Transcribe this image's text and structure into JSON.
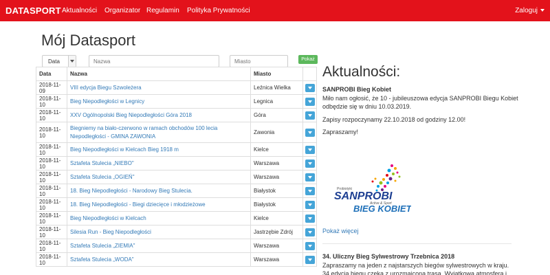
{
  "navbar": {
    "brand": "DATASPORT",
    "items": [
      "Aktualności",
      "Organizator",
      "Regulamin",
      "Polityka Prywatności"
    ],
    "login": "Zaloguj",
    "color": "#e3121b"
  },
  "page_title": "Mój Datasport",
  "filters": {
    "select_value": "Data",
    "name_placeholder": "Nazwa",
    "city_placeholder": "Miasto",
    "show_button": "Pokaż",
    "show_button_color": "#5cb85c"
  },
  "table": {
    "headers": [
      "Data",
      "Nazwa",
      "Miasto"
    ],
    "rows": [
      {
        "date": "2018-11-09",
        "name": "VIII edycja Biegu Szwoleżera",
        "city": "Leźnica Wielka"
      },
      {
        "date": "2018-11-10",
        "name": "Bieg Niepodległości w Legnicy",
        "city": "Legnica"
      },
      {
        "date": "2018-11-10",
        "name": "XXV Ogólnopolski Bieg Niepodległości Góra 2018",
        "city": "Góra"
      },
      {
        "date": "2018-11-10",
        "name": "Biegniemy na biało-czerwono w ramach obchodów 100 lecia Niepodległości - GMINA ZAWONIA",
        "city": "Zawonia"
      },
      {
        "date": "2018-11-10",
        "name": "Bieg Niepodległości w Kielcach Bieg 1918 m",
        "city": "Kielce"
      },
      {
        "date": "2018-11-10",
        "name": "Sztafeta Stulecia „NIEBO\"",
        "city": "Warszawa"
      },
      {
        "date": "2018-11-10",
        "name": "Sztafeta Stulecia „OGIEŃ\"",
        "city": "Warszawa"
      },
      {
        "date": "2018-11-10",
        "name": "18. Bieg Niepodległości - Narodowy Bieg Stulecia.",
        "city": "Białystok"
      },
      {
        "date": "2018-11-10",
        "name": "18. Bieg Niepodległości - Biegi dziecięce i młodzieżowe",
        "city": "Białystok"
      },
      {
        "date": "2018-11-10",
        "name": "Bieg Niepodległości w Kielcach",
        "city": "Kielce"
      },
      {
        "date": "2018-11-10",
        "name": "Silesia Run - Bieg Niepodległości",
        "city": "Jastrzębie Zdrój"
      },
      {
        "date": "2018-11-10",
        "name": "Sztafeta Stulecia „ZIEMIA\"",
        "city": "Warszawa"
      },
      {
        "date": "2018-11-10",
        "name": "Sztafeta Stulecia „WODA\"",
        "city": "Warszawa"
      }
    ],
    "action_icon": "chevron-down-icon",
    "action_color": "#45a5d8"
  },
  "news": {
    "title": "Aktualności:",
    "items": [
      {
        "headline": "SANPROBI Bieg Kobiet",
        "paragraphs": [
          "Miło nam ogłosić, że 10 - jubileuszowa edycja SANPROBI Biegu Kobiet odbędzie się w dniu 10.03.2019.",
          "Zapisy rozpoczynamy 22.10.2018 od godziny 12.00!",
          "Zapraszamy!"
        ],
        "logo": {
          "small": "Probiotyki",
          "brand": "SANPROBI",
          "tagline": "Active & Sport",
          "event": "BIEG KOBIET"
        },
        "more": "Pokaż więcej"
      },
      {
        "headline": "34. Uliczny Bieg Sylwestrowy Trzebnica 2018",
        "text": "Zapraszamy na jeden z najstarszych biegów sylwestrowych w kraju. 34 edycja biegu czeka z urozmaicona trasą. Wyjątkowa atmosfera i"
      }
    ]
  }
}
